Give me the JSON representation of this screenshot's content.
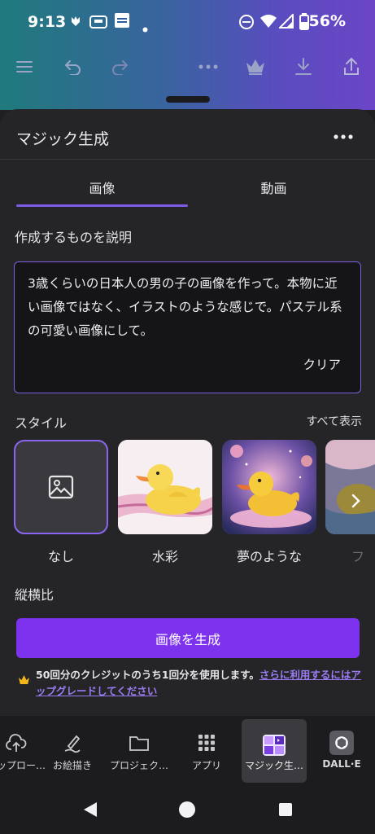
{
  "status_bar": {
    "time": "9:13",
    "battery": "56%"
  },
  "sheet": {
    "title": "マジック生成"
  },
  "tabs": [
    {
      "label": "画像"
    },
    {
      "label": "動画"
    }
  ],
  "describe": {
    "label": "作成するものを説明",
    "prompt": "3歳くらいの日本人の男の子の画像を作って。本物に近い画像ではなく、イラストのような感じで。パステル系の可愛い画像にして。",
    "clear_label": "クリア"
  },
  "style": {
    "label": "スタイル",
    "see_all": "すべて表示",
    "items": [
      {
        "name": "なし"
      },
      {
        "name": "水彩"
      },
      {
        "name": "夢のような"
      },
      {
        "name": "フ"
      }
    ]
  },
  "aspect_label": "縦横比",
  "generate_label": "画像を生成",
  "credit": {
    "text": "50回分のクレジットのうち1回分を使用します。",
    "upgrade_link": "さらに利用するにはアップグレードしてください"
  },
  "bottom_nav": [
    {
      "label": "アップロード",
      "display": "アップロー…",
      "icon": "upload-cloud-icon"
    },
    {
      "label": "お絵描き",
      "display": "お絵描き",
      "icon": "draw-icon"
    },
    {
      "label": "プロジェクト",
      "display": "プロジェク…",
      "icon": "folder-icon"
    },
    {
      "label": "アプリ",
      "display": "アプリ",
      "icon": "grid-icon"
    },
    {
      "label": "マジック生成",
      "display": "マジック生…",
      "icon": "magic-media-icon"
    },
    {
      "label": "DALL·E",
      "display": "DALL·E",
      "icon": "openai-icon"
    }
  ],
  "colors": {
    "accent": "#7d33ee",
    "sheet_bg": "#252528",
    "underline": "#7c5ce6"
  }
}
